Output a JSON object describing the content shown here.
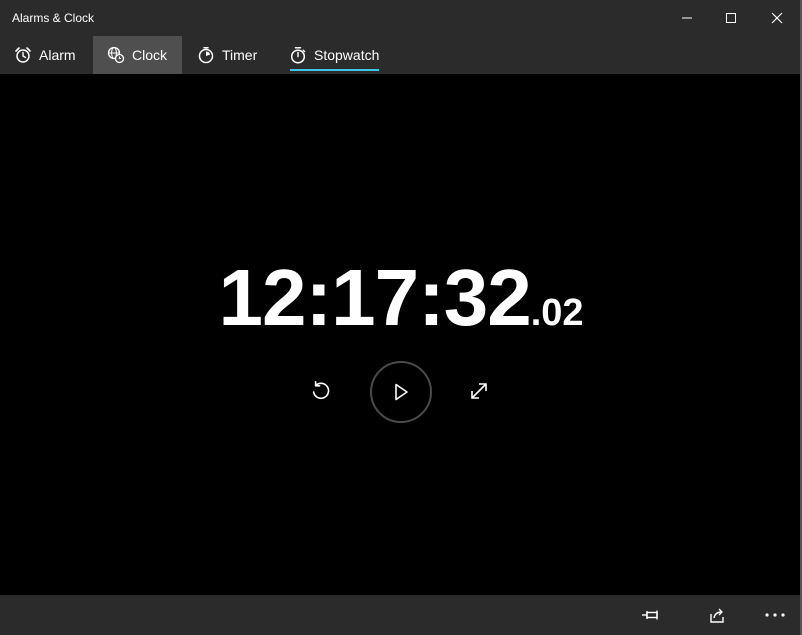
{
  "window": {
    "title": "Alarms & Clock"
  },
  "tabs": [
    {
      "label": "Alarm",
      "icon": "alarm-icon"
    },
    {
      "label": "Clock",
      "icon": "globe-clock-icon"
    },
    {
      "label": "Timer",
      "icon": "timer-icon"
    },
    {
      "label": "Stopwatch",
      "icon": "stopwatch-icon"
    }
  ],
  "selected_tab": "Stopwatch",
  "stopwatch": {
    "time": "12:17:32",
    "fraction": ".02"
  },
  "controls": [
    {
      "name": "reset",
      "icon": "reset-icon"
    },
    {
      "name": "start",
      "icon": "play-icon"
    },
    {
      "name": "expand",
      "icon": "expand-icon"
    }
  ],
  "appbar": [
    {
      "icon": "pin-icon"
    },
    {
      "icon": "share-icon"
    },
    {
      "icon": "more-icon"
    }
  ],
  "colors": {
    "accent": "#3ec6e6",
    "chrome": "#2b2b2b",
    "hover_tab": "#4f4f4f",
    "background": "#000000"
  }
}
